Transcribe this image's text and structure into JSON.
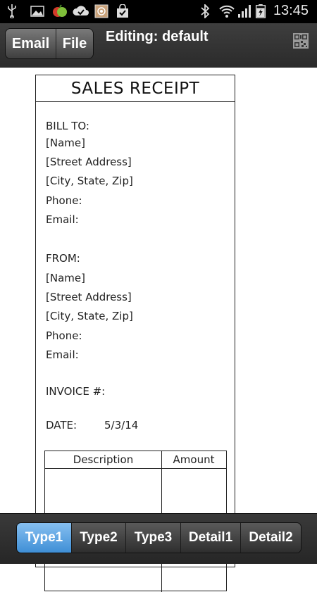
{
  "status_bar": {
    "time": "13:45",
    "icons": [
      "usb-icon",
      "image-icon",
      "fruit-app-icon",
      "sync-check-icon",
      "app-grid-icon",
      "shopping-bag-icon",
      "bluetooth-icon",
      "wifi-icon",
      "signal-icon",
      "battery-charging-icon"
    ]
  },
  "action_bar": {
    "email_label": "Email",
    "file_label": "File",
    "title": "Editing: default",
    "qr_icon": "qr-code-icon"
  },
  "receipt": {
    "title": "SALES RECEIPT",
    "bill_to": {
      "heading": "BILL TO:",
      "name": "[Name]",
      "street": "[Street Address]",
      "city": "[City, State, Zip]",
      "phone": "Phone:",
      "email": "Email:"
    },
    "from": {
      "heading": "FROM:",
      "name": "[Name]",
      "street": "[Street Address]",
      "city": "[City, State, Zip]",
      "phone": "Phone:",
      "email": "Email:"
    },
    "invoice_label": "INVOICE #:",
    "date_label": "DATE:",
    "date_value": "5/3/14",
    "table": {
      "headers": [
        "Description",
        "Amount"
      ]
    }
  },
  "tabs": [
    {
      "label": "Type1",
      "active": true
    },
    {
      "label": "Type2",
      "active": false
    },
    {
      "label": "Type3",
      "active": false
    },
    {
      "label": "Detail1",
      "active": false
    },
    {
      "label": "Detail2",
      "active": false
    }
  ],
  "colors": {
    "active_tab": "#4a9be0",
    "bar_dark": "#2b2b2b"
  }
}
